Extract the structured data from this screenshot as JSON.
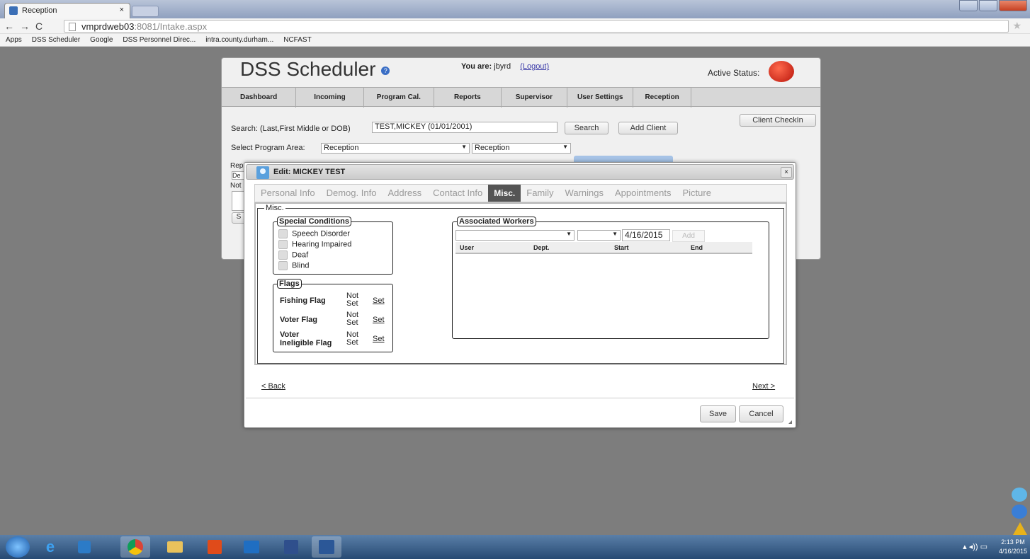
{
  "browser": {
    "tab_title": "Reception",
    "tab_close": "×",
    "url_host": "vmprdweb03",
    "url_rest": ":8081/Intake.aspx",
    "bookmarks": [
      "Apps",
      "DSS Scheduler",
      "Google",
      "DSS Personnel Direc...",
      "intra.county.durham...",
      "NCFAST"
    ]
  },
  "app": {
    "title": "DSS Scheduler",
    "help_glyph": "?",
    "you_are_label": "You are:",
    "username": "jbyrd",
    "logout": "(Logout)",
    "active_status_label": "Active Status:",
    "nav": [
      "Dashboard",
      "Incoming",
      "Program Cal.",
      "Reports",
      "Supervisor",
      "User Settings",
      "Reception"
    ],
    "search_label": "Search: (Last,First Middle or DOB)",
    "search_value": "TEST,MICKEY  (01/01/2001)",
    "search_button": "Search",
    "add_client_button": "Add Client",
    "client_checkin_button": "Client CheckIn",
    "program_label": "Select Program Area:",
    "program_value": "Reception",
    "program_value2": "Reception",
    "hidden_labels": [
      "Rep",
      "De",
      "Not",
      "S"
    ]
  },
  "modal": {
    "title": "Edit: MICKEY TEST",
    "close_glyph": "×",
    "tabs": [
      "Personal Info",
      "Demog. Info",
      "Address",
      "Contact Info",
      "Misc.",
      "Family",
      "Warnings",
      "Appointments",
      "Picture"
    ],
    "active_tab": "Misc.",
    "misc_legend": "Misc.",
    "special_conditions": {
      "legend": "Special Conditions",
      "items": [
        "Speech Disorder",
        "Hearing Impaired",
        "Deaf",
        "Blind"
      ]
    },
    "flags": {
      "legend": "Flags",
      "items": [
        {
          "name": "Fishing Flag",
          "status_line1": "Not",
          "status_line2": "Set",
          "action": "Set"
        },
        {
          "name": "Voter Flag",
          "status_line1": "Not",
          "status_line2": "Set",
          "action": "Set"
        },
        {
          "name_line1": "Voter",
          "name_line2": "Ineligible Flag",
          "status_line1": "Not",
          "status_line2": "Set",
          "action": "Set"
        }
      ]
    },
    "associated_workers": {
      "legend": "Associated Workers",
      "date_value": "4/16/2015",
      "add_button": "Add",
      "columns": [
        "User",
        "Dept.",
        "Start",
        "End"
      ]
    },
    "back_link": "< Back",
    "next_link": "Next >",
    "save_button": "Save",
    "cancel_button": "Cancel"
  },
  "taskbar": {
    "time": "2:13 PM",
    "date": "4/16/2015"
  }
}
